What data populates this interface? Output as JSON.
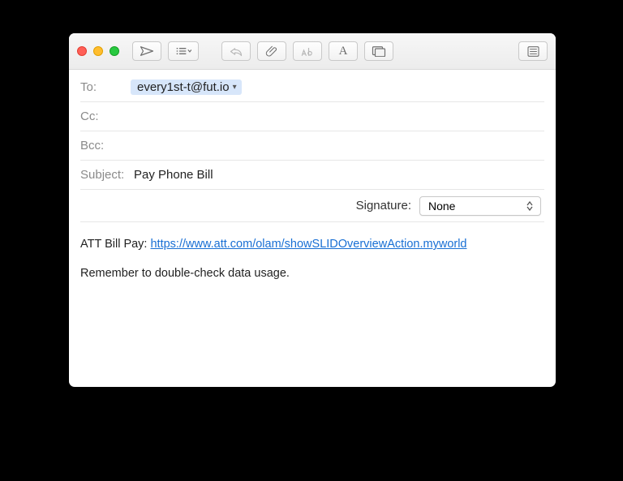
{
  "header": {
    "to_label": "To:",
    "cc_label": "Cc:",
    "bcc_label": "Bcc:",
    "subject_label": "Subject:",
    "recipient": "every1st-t@fut.io",
    "subject_value": "Pay Phone Bill",
    "signature_label": "Signature:",
    "signature_value": "None"
  },
  "body": {
    "line1_prefix": "ATT Bill Pay: ",
    "line1_link": "https://www.att.com/olam/showSLIDOverviewAction.myworld",
    "line2": "Remember to double-check data usage."
  },
  "toolbar": {
    "send": "send-icon",
    "header_menu": "header-options-icon",
    "reply": "reply-icon",
    "attach": "paperclip-icon",
    "markup": "markup-icon",
    "fonts": "font-icon",
    "photo": "photo-browser-icon",
    "list": "list-icon"
  }
}
